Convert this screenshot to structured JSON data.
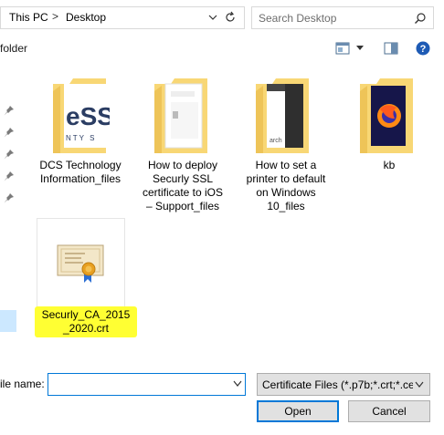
{
  "address_bar": {
    "segments": [
      "This PC",
      "Desktop"
    ],
    "separator": ">"
  },
  "search": {
    "placeholder": "Search Desktop"
  },
  "toolbar": {
    "new_folder_label": "folder"
  },
  "items": [
    {
      "label_lines": [
        "DCS Technology",
        "Information_files"
      ],
      "icon": "folder-icon"
    },
    {
      "label_lines": [
        "How to deploy",
        "Securly SSL",
        "certificate to iOS",
        "– Support_files"
      ],
      "icon": "folder-icon"
    },
    {
      "label_lines": [
        "How to set a",
        "printer to default",
        "on Windows",
        "10_files"
      ],
      "icon": "folder-icon"
    },
    {
      "label_lines": [
        "kb"
      ],
      "icon": "folder-icon"
    },
    {
      "label_lines": [
        "Securly_CA_2015",
        "_2020.crt"
      ],
      "icon": "certificate-icon",
      "highlighted": true
    }
  ],
  "bottom": {
    "file_name_label": "ile name:",
    "file_name_value": "",
    "file_type_value": "Certificate Files (*.p7b;*.crt;*.ce",
    "open_label": "Open",
    "cancel_label": "Cancel"
  },
  "colors": {
    "accent": "#0078d7",
    "highlight": "#ffff00",
    "folder": "#f8d775",
    "help": "#1e5bb5"
  }
}
